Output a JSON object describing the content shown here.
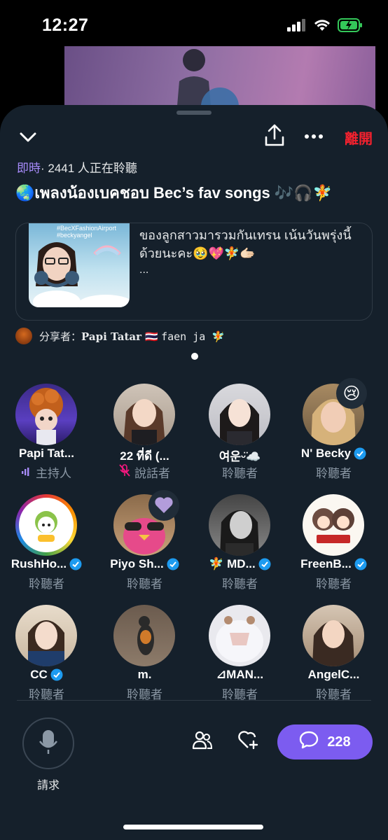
{
  "status": {
    "time": "12:27"
  },
  "header": {
    "leave_label": "離開"
  },
  "live": {
    "badge": "即時",
    "listeners_text": "· 2441 人正在聆聽"
  },
  "space": {
    "title": "🌏เพลงน้องเบคชอบ Bec’s fav songs 🎶🎧🧚"
  },
  "card": {
    "thumb_tag": "#BecXFashionAirport #beckyangel",
    "text": "ของลูกสาวมารวมกันเทรน เน้นวันพรุ่งนี้ด้วยนะคะ🥹💖🧚🫱🏻",
    "ellipsis": "..."
  },
  "sharer": {
    "prefix": "分享者：",
    "name": "Papi Tatar 🇹🇭",
    "extra": "faen ja 🧚"
  },
  "participants": [
    {
      "name": "Papi Tat...",
      "role": "主持人",
      "role_icon": "speaking-bars-icon",
      "verified": false
    },
    {
      "name": "22 ที่ดี (...",
      "role": "說話者",
      "role_icon": "muted-mic-icon",
      "verified": false
    },
    {
      "name": "여운ᵕ̈☁️",
      "role": "聆聽者",
      "verified": false
    },
    {
      "name": "N' Becky",
      "role": "聆聽者",
      "verified": true,
      "badge_emoji": "😢"
    },
    {
      "name": "RushHo...",
      "role": "聆聽者",
      "verified": true
    },
    {
      "name": "Piyo Sh...",
      "role": "聆聽者",
      "verified": true,
      "badge_emoji": "💜"
    },
    {
      "name": "🧚 MD...",
      "role": "聆聽者",
      "verified": true
    },
    {
      "name": "FreenB...",
      "role": "聆聽者",
      "verified": true
    },
    {
      "name": "CC",
      "role": "聆聽者",
      "verified": true
    },
    {
      "name": "m.",
      "role": "聆聽者",
      "verified": false
    },
    {
      "name": "⊿MAN...",
      "role": "聆聽者",
      "verified": false
    },
    {
      "name": "AngelC...",
      "role": "聆聽者",
      "verified": false
    }
  ],
  "bottom": {
    "request_label": "請求",
    "comment_count": "228"
  },
  "colors": {
    "background": "#15202b",
    "accent": "#7c5cf0",
    "leave": "#f4212e",
    "verified": "#1d9bf0"
  }
}
